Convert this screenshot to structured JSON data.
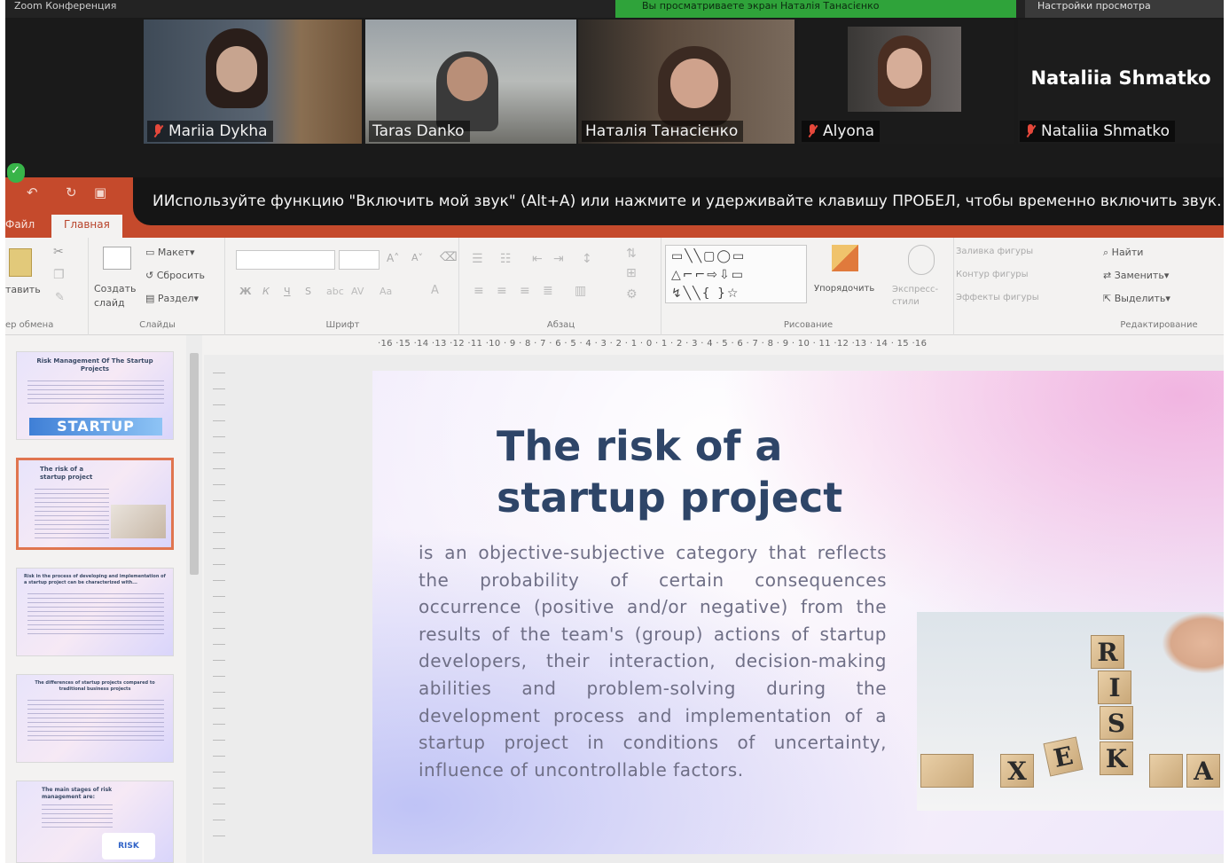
{
  "zoom": {
    "window_title": "Zoom Конференция",
    "active_speaker_text": "Вы просматриваете экран Наталія Танасієнко",
    "view_options_label": "Настройки просмотра",
    "participants": [
      {
        "name": "Mariia Dykha",
        "muted": true
      },
      {
        "name": "Taras Danko",
        "muted": false
      },
      {
        "name": "Наталія Танасієнко",
        "muted": false
      },
      {
        "name": "Alyona",
        "muted": true
      },
      {
        "name": "Nataliia Shmatko",
        "muted": true,
        "display_name": "Nataliia Shmatko"
      }
    ],
    "hint": "ИИспользуйте функцию \"Включить мой звук\" (Alt+A) или нажмите и удерживайте клавишу ПРОБЕЛ, чтобы временно включить звук."
  },
  "ppt": {
    "tabs": {
      "file": "Файл",
      "home": "Главная"
    },
    "ribbon": {
      "paste": "тавить",
      "clipboard_group": "ер обмена",
      "new_slide": "Создать слайд",
      "layout": "Макет",
      "reset": "Сбросить",
      "section": "Раздел",
      "slides_group": "Слайды",
      "font_bold": "Ж",
      "font_italic": "К",
      "font_underline": "Ч",
      "font_shadow": "S",
      "font_group": "Шрифт",
      "paragraph_group": "Абзац",
      "arrange": "Упорядочить",
      "quick_styles": "Экспресс-стили",
      "shape_fill": "Заливка фигуры",
      "shape_outline": "Контур фигуры",
      "shape_effects": "Эффекты фигуры",
      "drawing_group": "Рисование",
      "find": "Найти",
      "replace": "Заменить",
      "select": "Выделить",
      "editing_group": "Редактирование"
    },
    "ruler_text": "·16 ·15 ·14 ·13 ·12 ·11 ·10 · 9 · 8 · 7 · 6 · 5 · 4 · 3 · 2 · 1 · 0 · 1 · 2 · 3 · 4 · 5 · 6 · 7 · 8 · 9 · 10 · 11 ·12 ·13 · 14 · 15 ·16",
    "thumbnails": [
      {
        "title": "Risk Management Of The Startup Projects",
        "banner": "STARTUP"
      },
      {
        "title": "The risk of a startup project"
      },
      {
        "title": "Risk in the process of developing and implementation of a startup project can be characterized with..."
      },
      {
        "title": "The differences of startup projects compared to traditional business projects"
      },
      {
        "title": "The main stages of risk management are:",
        "badge": "RISK"
      }
    ],
    "slide": {
      "title": "The risk of a startup project",
      "body": "is an objective-subjective category that reflects the probability of certain consequences occurrence (positive and/or negative) from the results of the team's (group) actions of startup developers, their interaction, decision-making abilities and problem-solving during the development process and implementation of a startup project in conditions of uncertainty, influence of uncontrollable factors.",
      "photo_letters": [
        "R",
        "I",
        "S",
        "K",
        "X",
        "E",
        "A"
      ]
    }
  }
}
